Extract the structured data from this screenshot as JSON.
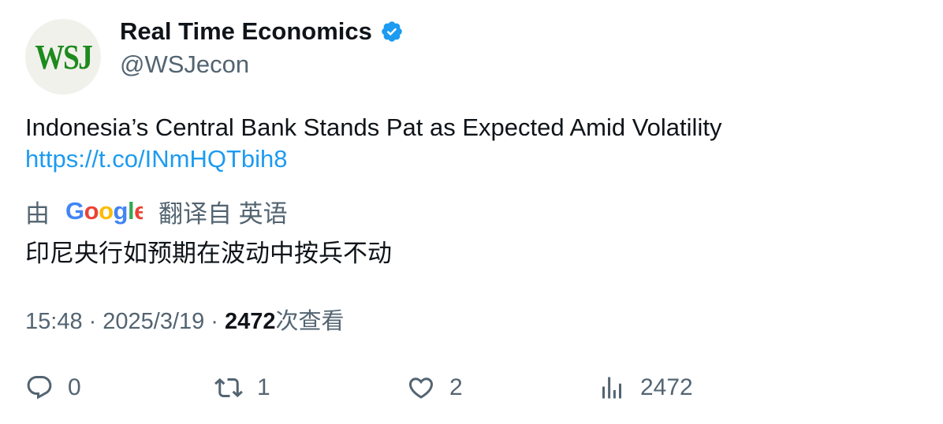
{
  "author": {
    "avatar_text": "WSJ",
    "display_name": "Real Time Economics",
    "handle": "@WSJecon",
    "verified": true,
    "verified_color": "#1d9bf0"
  },
  "tweet": {
    "text": "Indonesia’s Central Bank Stands Pat as Expected Amid Volatility",
    "link": "https://t.co/INmHQTbih8"
  },
  "translation": {
    "prefix": "由",
    "provider": "Google",
    "suffix": "翻译自 英语",
    "text": "印尼央行如预期在波动中按兵不动"
  },
  "meta": {
    "time": "15:48",
    "separator": "·",
    "date": "2025/3/19",
    "views_count": "2472",
    "views_label": "次查看"
  },
  "actions": {
    "replies": "0",
    "retweets": "1",
    "likes": "2",
    "views": "2472"
  },
  "colors": {
    "text": "#0f1419",
    "secondary": "#536471",
    "link": "#1d9bf0",
    "avatar_bg": "#f1f1ec",
    "avatar_fg": "#1d8a1d"
  }
}
